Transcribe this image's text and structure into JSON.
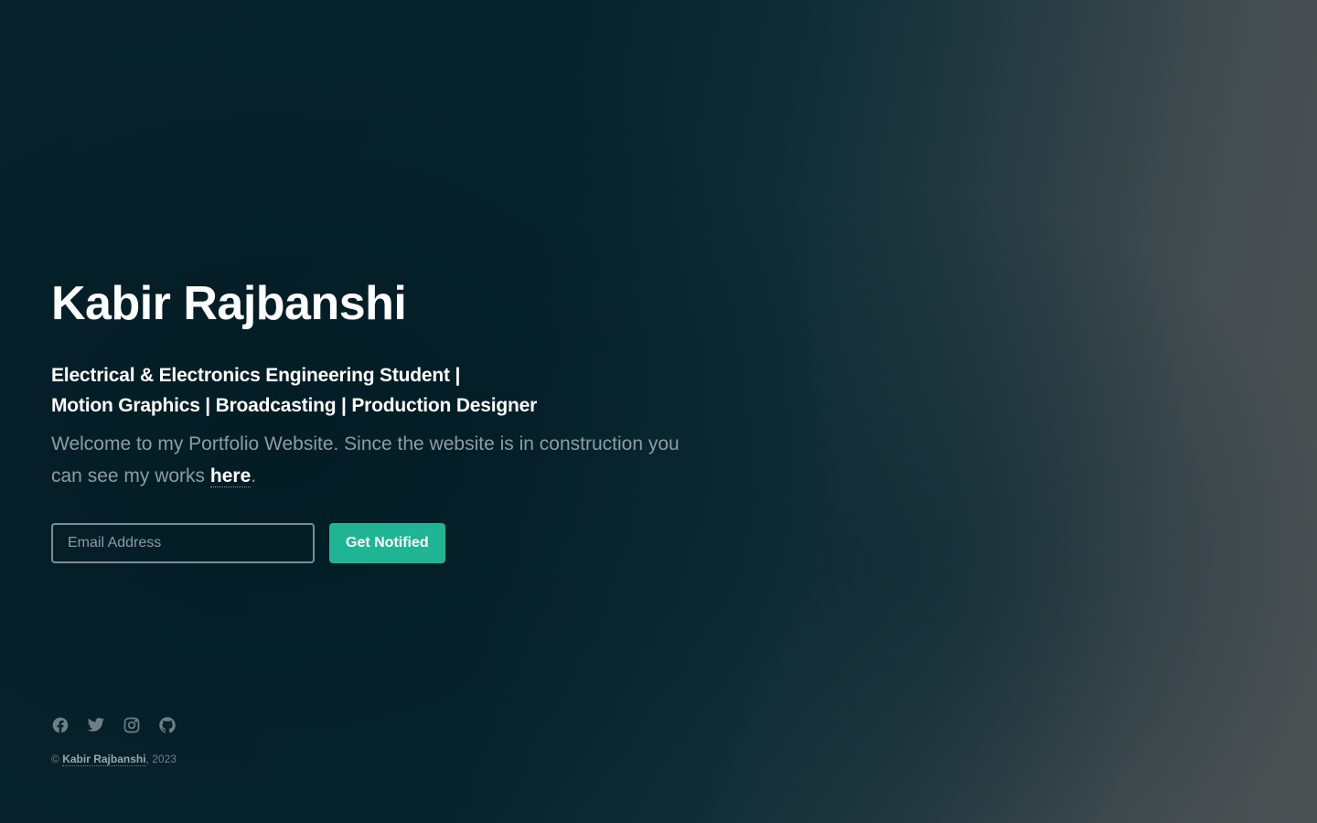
{
  "hero": {
    "name": "Kabir Rajbanshi",
    "subtitle_line1": "Electrical & Electronics Engineering Student |",
    "subtitle_line2": "Motion Graphics | Broadcasting | Production Designer",
    "intro_before_link": "Welcome to my Portfolio Website. Since the website is in construction you can see my works ",
    "intro_link": "here",
    "intro_after_link": "."
  },
  "form": {
    "email_placeholder": "Email Address",
    "submit_label": "Get Notified"
  },
  "social": {
    "icons": [
      "facebook-icon",
      "twitter-icon",
      "instagram-icon",
      "github-icon"
    ]
  },
  "footer": {
    "copyright_symbol": "©",
    "owner": "Kabir Rajbanshi",
    "year_text": ", 2023"
  },
  "colors": {
    "accent": "#1fb594",
    "background": "#07222c",
    "muted_text": "#8e9ca3"
  }
}
